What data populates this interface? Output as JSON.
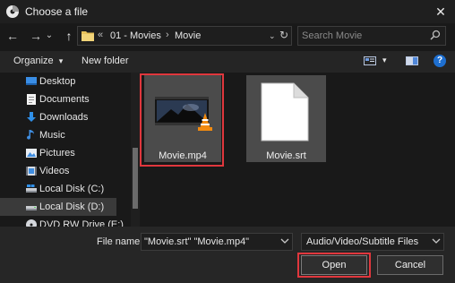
{
  "window": {
    "title": "Choose a file",
    "close_glyph": "✕"
  },
  "nav": {
    "back_glyph": "←",
    "forward_glyph": "→",
    "dropdown_glyph": "⌄",
    "up_glyph": "↑"
  },
  "address": {
    "overflow_glyph": "«",
    "crumbs": [
      "01 - Movies",
      "Movie"
    ],
    "separator": "›",
    "dropdown_glyph": "⌄",
    "refresh_glyph": "↻"
  },
  "search": {
    "placeholder": "Search Movie"
  },
  "toolbar": {
    "organize_label": "Organize",
    "organize_caret": "▾",
    "new_folder_label": "New folder",
    "view_caret": "▾",
    "help_glyph": "?"
  },
  "sidebar": {
    "items": [
      {
        "label": "Desktop",
        "icon": "desktop-icon"
      },
      {
        "label": "Documents",
        "icon": "documents-icon"
      },
      {
        "label": "Downloads",
        "icon": "downloads-icon"
      },
      {
        "label": "Music",
        "icon": "music-icon"
      },
      {
        "label": "Pictures",
        "icon": "pictures-icon"
      },
      {
        "label": "Videos",
        "icon": "videos-icon"
      },
      {
        "label": "Local Disk (C:)",
        "icon": "drive-icon"
      },
      {
        "label": "Local Disk (D:)",
        "icon": "drive-icon",
        "selected": true
      },
      {
        "label": "DVD RW Drive (E:)",
        "icon": "dvd-icon"
      }
    ]
  },
  "files": [
    {
      "name": "Movie.mp4",
      "icon": "video-thumbnail-vlc-icon",
      "highlighted": true
    },
    {
      "name": "Movie.srt",
      "icon": "blank-document-icon",
      "highlighted": false
    }
  ],
  "bottom": {
    "file_name_label": "File name:",
    "file_name_value": "\"Movie.srt\" \"Movie.mp4\"",
    "file_type_value": "Audio/Video/Subtitle Files",
    "open_label": "Open",
    "cancel_label": "Cancel"
  },
  "colors": {
    "highlight": "#e0373d",
    "selected_bg": "#3a3a3a",
    "folder": "#e8c25b",
    "help": "#1e6fd0"
  }
}
